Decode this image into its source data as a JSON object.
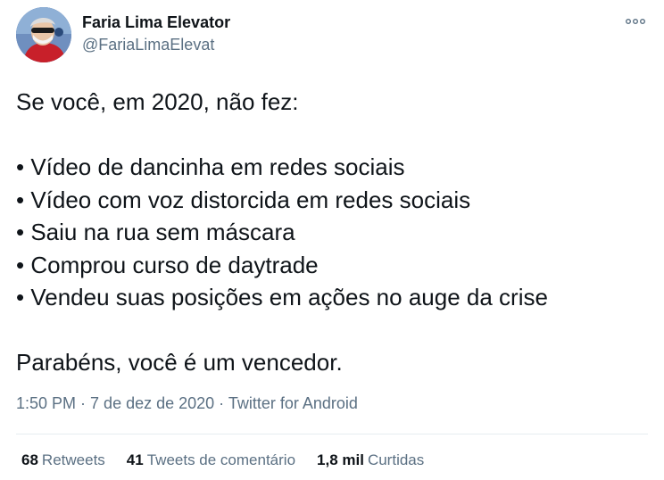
{
  "author": {
    "name": "Faria Lima Elevator",
    "handle": "@FariaLimaElevat"
  },
  "tweet": {
    "intro": "Se você, em 2020, não fez:",
    "items": [
      "• Vídeo de dancinha em redes sociais",
      "• Vídeo com voz distorcida em redes sociais",
      "• Saiu na rua sem máscara",
      "• Comprou curso de daytrade",
      "• Vendeu suas posições em ações no auge da crise"
    ],
    "closing": "Parabéns, você é um vencedor."
  },
  "meta": {
    "time": "1:50 PM",
    "separator": " · ",
    "date": "7 de dez de 2020",
    "source": "Twitter for Android"
  },
  "stats": {
    "retweets_count": "68",
    "retweets_label": "Retweets",
    "quotes_count": "41",
    "quotes_label": "Tweets de comentário",
    "likes_count": "1,8 mil",
    "likes_label": "Curtidas"
  },
  "icons": {
    "more": "more-options-icon",
    "avatar": "profile-photo"
  },
  "colors": {
    "text": "#0f1419",
    "secondary": "#5b7083",
    "divider": "#e6ecf0"
  }
}
